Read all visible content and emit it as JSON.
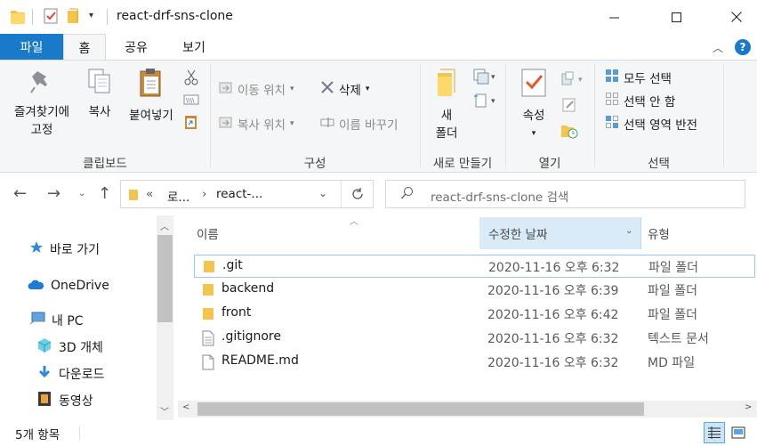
{
  "window": {
    "title": "react-drf-sns-clone"
  },
  "ribbon_tabs": {
    "file": "파일",
    "home": "홈",
    "share": "공유",
    "view": "보기"
  },
  "clipboard": {
    "pin_line1": "즐겨찾기에",
    "pin_line2": "고정",
    "copy": "복사",
    "paste": "붙여넣기",
    "group": "클립보드"
  },
  "organize": {
    "move_to": "이동 위치",
    "copy_to": "복사 위치",
    "delete": "삭제",
    "rename": "이름 바꾸기",
    "group": "구성"
  },
  "new": {
    "folder_line1": "새",
    "folder_line2": "폴더",
    "group": "새로 만들기"
  },
  "open": {
    "properties": "속성",
    "group": "열기"
  },
  "select": {
    "select_all": "모두 선택",
    "select_none": "선택 안 함",
    "invert": "선택 영역 반전",
    "group": "선택"
  },
  "address": {
    "ellipsis": "«",
    "crumb1": "로...",
    "crumb2": "react-...",
    "search_placeholder": "react-drf-sns-clone 검색"
  },
  "nav_pane": {
    "quick_access": "바로 가기",
    "onedrive": "OneDrive",
    "this_pc": "내 PC",
    "objects_3d": "3D 개체",
    "downloads": "다운로드",
    "videos": "동영상"
  },
  "columns": {
    "name": "이름",
    "date": "수정한 날짜",
    "type": "유형"
  },
  "files": [
    {
      "name": ".git",
      "date": "2020-11-16 오후 6:32",
      "type": "파일 폴더",
      "icon": "folder-icon"
    },
    {
      "name": "backend",
      "date": "2020-11-16 오후 6:39",
      "type": "파일 폴더",
      "icon": "folder-icon"
    },
    {
      "name": "front",
      "date": "2020-11-16 오후 6:42",
      "type": "파일 폴더",
      "icon": "folder-icon"
    },
    {
      "name": ".gitignore",
      "date": "2020-11-16 오후 6:32",
      "type": "텍스트 문서",
      "icon": "text-file-icon"
    },
    {
      "name": "README.md",
      "date": "2020-11-16 오후 6:32",
      "type": "MD 파일",
      "icon": "file-icon"
    }
  ],
  "status": {
    "item_count": "5개 항목"
  },
  "colors": {
    "accent": "#1979ca",
    "folder": "#f3c44e",
    "selection_border": "#99c9ef",
    "sorted_column": "#d9ebf9"
  }
}
